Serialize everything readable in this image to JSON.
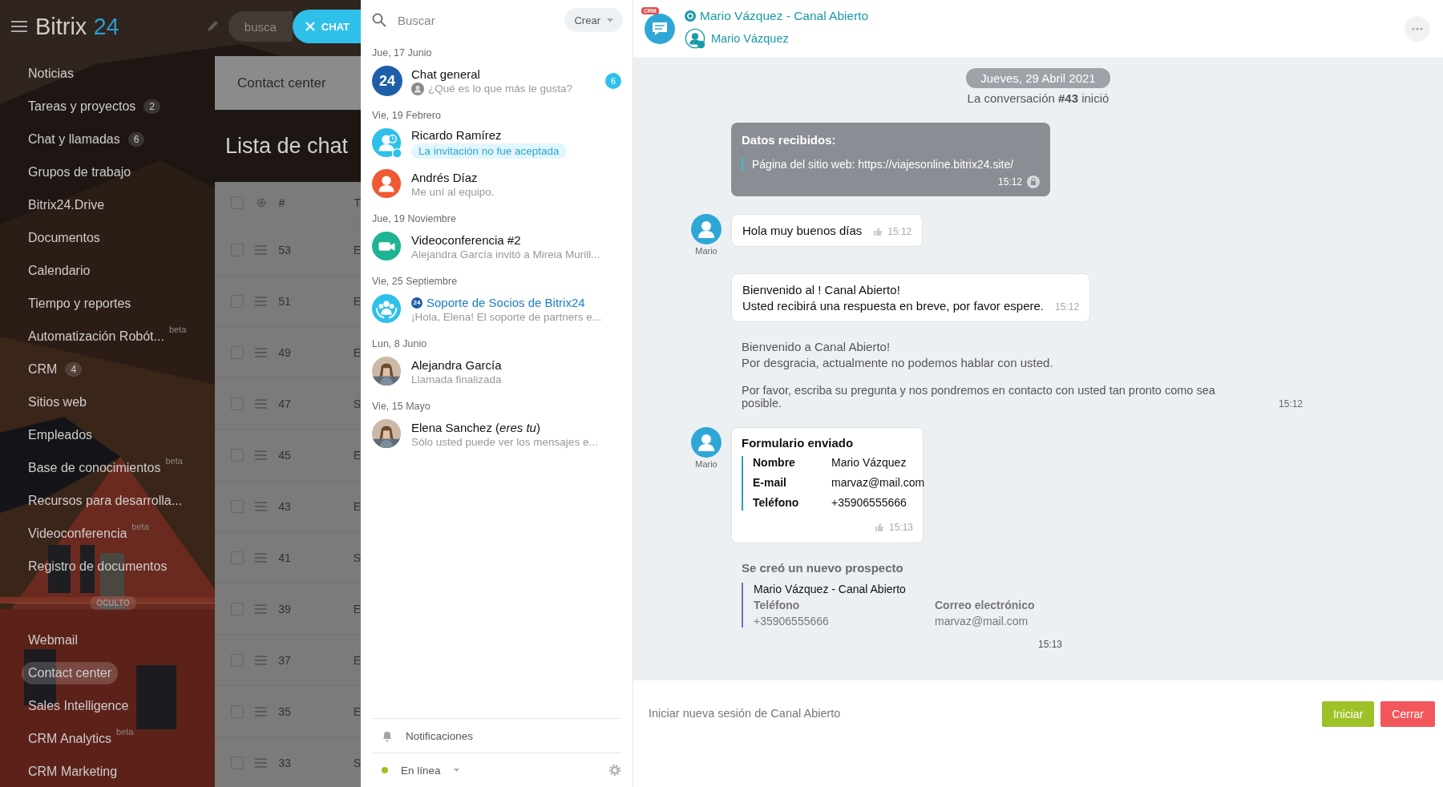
{
  "portal": {
    "logo": {
      "name": "Bitrix",
      "number": "24"
    },
    "search_placeholder": "busca",
    "chat_button": "CHAT",
    "menu": [
      {
        "label": "Noticias",
        "selected": false
      },
      {
        "label": "Tareas y proyectos",
        "counter": "2",
        "selected": false
      },
      {
        "label": "Chat y llamadas",
        "counter": "6",
        "selected": false
      },
      {
        "label": "Grupos de trabajo",
        "selected": false
      },
      {
        "label": "Bitrix24.Drive",
        "selected": false
      },
      {
        "label": "Documentos",
        "selected": false
      },
      {
        "label": "Calendario",
        "selected": false
      },
      {
        "label": "Tiempo y reportes",
        "selected": false
      },
      {
        "label": "Automatización Robót...",
        "tag": "beta",
        "selected": false
      },
      {
        "label": "CRM",
        "counter": "4",
        "selected": false
      },
      {
        "label": "Sitios web",
        "selected": false
      },
      {
        "label": "Empleados",
        "selected": false
      },
      {
        "label": "Base de conocimientos",
        "tag": "beta",
        "selected": false
      },
      {
        "label": "Recursos para desarrolla...",
        "selected": false
      },
      {
        "label": "Videoconferencia",
        "tag": "beta",
        "selected": false
      },
      {
        "label": "Registro de documentos",
        "selected": false
      }
    ],
    "hidden_label": "OCULTO",
    "hidden_menu": [
      {
        "label": "Webmail",
        "selected": false
      },
      {
        "label": "Contact center",
        "selected": true
      },
      {
        "label": "Sales Intelligence",
        "selected": false
      },
      {
        "label": "CRM Analytics",
        "tag": "beta",
        "selected": false
      },
      {
        "label": "CRM Marketing",
        "selected": false
      }
    ],
    "page": {
      "tab": "Contact center",
      "title": "Lista de chat",
      "table": {
        "all_checked": false,
        "columns": [
          "#",
          "T"
        ],
        "rows": [
          {
            "checked": false,
            "number": "53",
            "column_2": "E"
          },
          {
            "checked": false,
            "number": "51",
            "column_2": "E"
          },
          {
            "checked": false,
            "number": "49",
            "column_2": "E"
          },
          {
            "checked": false,
            "number": "47",
            "column_2": "S"
          },
          {
            "checked": false,
            "number": "45",
            "column_2": "E"
          },
          {
            "checked": false,
            "number": "43",
            "column_2": "E"
          },
          {
            "checked": false,
            "number": "41",
            "column_2": "S"
          },
          {
            "checked": false,
            "number": "39",
            "column_2": "E"
          },
          {
            "checked": false,
            "number": "37",
            "column_2": "E"
          },
          {
            "checked": false,
            "number": "35",
            "column_2": "E"
          },
          {
            "checked": false,
            "number": "33",
            "column_2": "S"
          }
        ]
      }
    }
  },
  "chat_list": {
    "search_placeholder": "Buscar",
    "create_button": "Crear",
    "groups": [
      {
        "date": "Jue, 17 Junio",
        "chats": [
          {
            "kind": "logo",
            "avatar_text": "24",
            "name": "Chat general",
            "preview": "¿Qué es lo que más le gusta?",
            "counter": "6"
          }
        ]
      },
      {
        "date": "Vie, 19 Febrero",
        "chats": [
          {
            "kind": "invited",
            "name": "Ricardo Ramírez",
            "notice": "La invitación no fue aceptada"
          },
          {
            "kind": "user",
            "name": "Andrés Díaz",
            "preview": "Me uní al equipo."
          }
        ]
      },
      {
        "date": "Jue, 19 Noviembre",
        "chats": [
          {
            "kind": "video",
            "name": "Videoconferencia #2",
            "preview": "Alejandra García invitó a Mireia Murill..."
          }
        ]
      },
      {
        "date": "Vie, 25 Septiembre",
        "chats": [
          {
            "kind": "support",
            "badge": "24",
            "name": "Soporte de Socios de Bitrix24",
            "preview": "¡Hola, Elena! El soporte de partners e..."
          }
        ]
      },
      {
        "date": "Lun, 8 Junio",
        "chats": [
          {
            "name": "Alejandra García",
            "preview": "Llamada finalizada"
          }
        ]
      },
      {
        "date": "Vie, 15 Mayo",
        "chats": [
          {
            "name": "Elena Sanchez (*eres tu*)",
            "preview": "Sólo usted puede ver los mensajes e..."
          }
        ]
      }
    ],
    "notifications": "Notificaciones",
    "status": "En línea"
  },
  "chat": {
    "badge": "CRM",
    "title": "Mario Vázquez - Canal Abierto",
    "subtitle": "Mario Vázquez",
    "date": "Jueves, 29 Abril 2021",
    "started": "La conversación **#43** inició",
    "messages": [
      {
        "kind": "data",
        "title": "Datos recibidos:",
        "quote": "Página del sitio web: https://viajesonline.bitrix24.site/",
        "time": "15:12"
      },
      {
        "kind": "text",
        "author": "Mario",
        "lines": [
          "Hola muy buenos días"
        ],
        "like": true,
        "time": "15:12"
      },
      {
        "kind": "text",
        "lines": [
          "Bienvenido al ! Canal Abierto!",
          "Usted recibirá una respuesta en breve, por favor espere."
        ],
        "like": false,
        "time": "15:12"
      },
      {
        "kind": "note",
        "paragraphs": [
          [
            "Bienvenido a Canal Abierto!",
            "Por desgracia, actualmente no podemos hablar con usted."
          ],
          [
            "Por favor, escriba su pregunta y nos pondremos en contacto con usted tan pronto como sea posible."
          ]
        ],
        "time": "15:12"
      },
      {
        "kind": "form",
        "author": "Mario",
        "title": "Formulario enviado",
        "fields": [
          {
            "label": "Nombre",
            "value": "Mario Vázquez"
          },
          {
            "label": "E-mail",
            "value": "marvaz@mail.com"
          },
          {
            "label": "Teléfono",
            "value": "+35906555666"
          }
        ],
        "like": true,
        "time": "15:13"
      },
      {
        "kind": "lead",
        "title": "Se creó un nuevo prospecto",
        "entity": "Mario Vázquez - Canal Abierto",
        "fields": [
          {
            "label": "Teléfono",
            "value": "+35906555666"
          },
          {
            "label": "Correo electrónico",
            "value": "marvaz@mail.com"
          }
        ],
        "time": "15:13"
      }
    ],
    "footer": {
      "text": "Iniciar nueva sesión de Canal Abierto",
      "buttons": [
        {
          "label": "Iniciar",
          "kind": "primary"
        },
        {
          "label": "Cerrar",
          "kind": "danger"
        }
      ]
    }
  }
}
